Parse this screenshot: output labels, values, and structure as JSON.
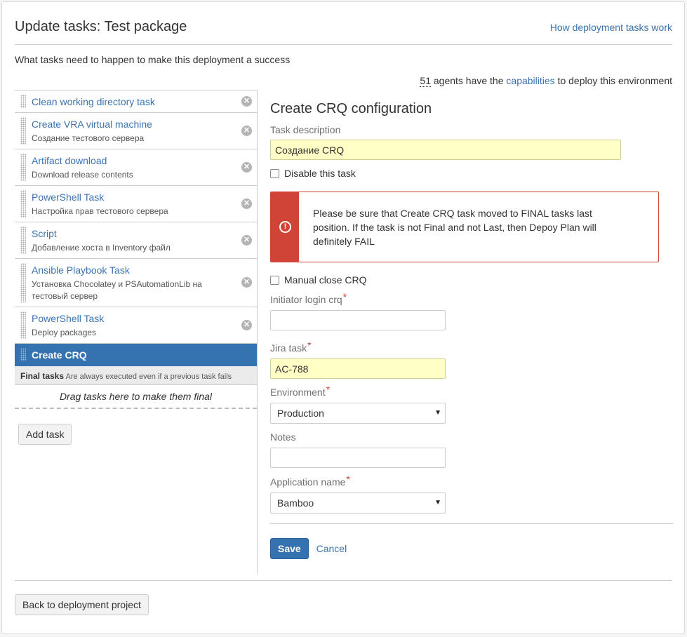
{
  "header": {
    "title": "Update tasks: Test package",
    "help_link": "How deployment tasks work",
    "subtitle": "What tasks need to happen to make this deployment a success",
    "agents_count": "51",
    "agents_text_1": "agents have the",
    "agents_link": "capabilities",
    "agents_text_2": "to deploy this environment"
  },
  "tasks": [
    {
      "title": "Clean working directory task",
      "desc": ""
    },
    {
      "title": "Create VRA virtual machine",
      "desc": "Создание тестового сервера"
    },
    {
      "title": "Artifact download",
      "desc": "Download release contents"
    },
    {
      "title": "PowerShell Task",
      "desc": "Настройка прав тестового сервера"
    },
    {
      "title": "Script",
      "desc": "Добавление хоста в Inventory файл"
    },
    {
      "title": "Ansible Playbook Task",
      "desc": "Установка Chocolatey и PSAutomationLib на тестовый сервер"
    },
    {
      "title": "PowerShell Task",
      "desc": "Deploy packages"
    },
    {
      "title": "Create CRQ",
      "desc": ""
    }
  ],
  "final_tasks": {
    "label": "Final tasks",
    "note": "Are always executed even if a previous task fails",
    "drop_hint": "Drag tasks here to make them final"
  },
  "buttons": {
    "add_task": "Add task",
    "save": "Save",
    "cancel": "Cancel",
    "back": "Back to deployment project"
  },
  "config": {
    "title": "Create CRQ configuration",
    "task_description_label": "Task description",
    "task_description_value": "Создание CRQ",
    "disable_label": "Disable this task",
    "warning": "Please be sure that Create CRQ task moved to FINAL tasks last position. If the task is not Final and not Last, then Depoy Plan will definitely FAIL",
    "manual_close_label": "Manual close CRQ",
    "initiator_label": "Initiator login crq",
    "initiator_value": "",
    "jira_label": "Jira task",
    "jira_value": "AC-788",
    "environment_label": "Environment",
    "environment_value": "Production",
    "notes_label": "Notes",
    "notes_value": "",
    "app_name_label": "Application name",
    "app_name_value": "Bamboo",
    "required_mark": "*"
  },
  "icons": {
    "remove": "remove-icon",
    "warning": "error-icon",
    "drag": "drag-handle-icon",
    "caret": "chevron-down-icon"
  },
  "colors": {
    "link": "#3b73af",
    "primary": "#3572b0",
    "error": "#d04437",
    "filled_input": "#ffffc6"
  }
}
